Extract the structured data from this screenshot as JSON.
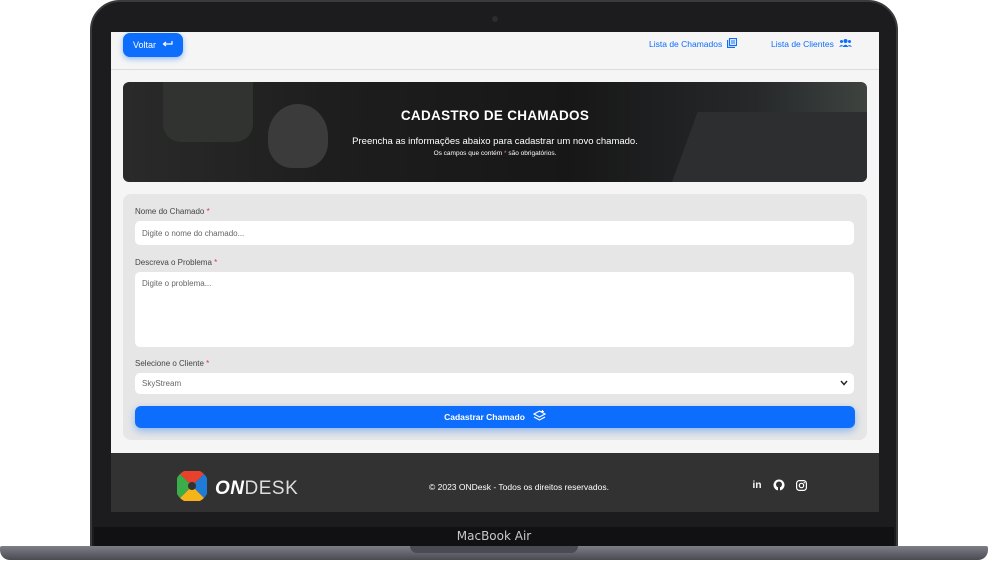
{
  "nav": {
    "back_label": "Voltar",
    "link_chamados": "Lista de Chamados",
    "link_clientes": "Lista de Clientes"
  },
  "hero": {
    "title": "CADASTRO DE CHAMADOS",
    "subtitle": "Preencha as informações abaixo para cadastrar um novo chamado.",
    "note_pre": "Os campos que contém ",
    "note_star": "*",
    "note_post": " são obrigatórios."
  },
  "form": {
    "name_label": "Nome do Chamado",
    "name_placeholder": "Digite o nome do chamado...",
    "desc_label": "Descreva o Problema",
    "desc_placeholder": "Digite o problema...",
    "client_label": "Selecione o Cliente",
    "client_selected": "SkyStream",
    "required_mark": "*",
    "submit_label": "Cadastrar Chamado"
  },
  "footer": {
    "logo_on": "ON",
    "logo_desk": "DESK",
    "copyright": "© 2023 ONDesk - Todos os direitos reservados."
  },
  "device": {
    "model": "MacBook Air"
  },
  "colors": {
    "primary": "#0d6efd",
    "footer_bg": "#323232",
    "required": "#dc3545"
  }
}
